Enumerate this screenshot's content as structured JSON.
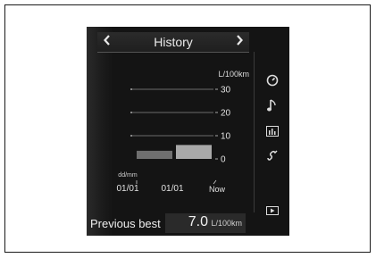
{
  "header": {
    "title": "History",
    "prev_icon": "chevron-left",
    "next_icon": "chevron-right"
  },
  "chart_data": {
    "type": "bar",
    "unit_label": "L/100km",
    "categories": [
      "01/01",
      "01/01",
      "Now"
    ],
    "period_label": "dd/mm",
    "values": [
      3.5,
      6,
      null
    ],
    "y_ticks": [
      "30",
      "20",
      "10",
      "0"
    ],
    "ylim": [
      0,
      30
    ]
  },
  "sidebar": {
    "icons": [
      "gauge-icon",
      "music-note-icon",
      "equalizer-icon",
      "phone-icon",
      "media-icon"
    ]
  },
  "footer": {
    "label": "Previous best",
    "value": "7.0",
    "unit": "L/100km"
  }
}
